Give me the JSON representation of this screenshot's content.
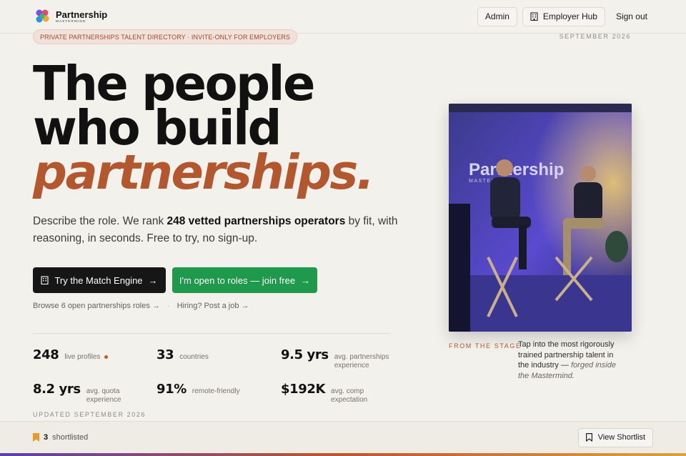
{
  "header": {
    "brand_name": "Partnership",
    "brand_sub": "MASTERMIND",
    "nav": {
      "admin": "Admin",
      "employer_hub": "Employer Hub",
      "sign_out": "Sign out"
    }
  },
  "banner": {
    "pill": "PRIVATE PARTNERSHIPS TALENT DIRECTORY · INVITE-ONLY FOR EMPLOYERS",
    "date": "SEPTEMBER 2026"
  },
  "hero": {
    "line1": "The people",
    "line2": "who build",
    "line3": "partnerships.",
    "lede_pre": "Describe the role. We rank ",
    "lede_bold": "248 vetted partnerships operators",
    "lede_post": " by fit, with reasoning, in seconds. Free to try, no sign-up.",
    "cta_primary": "Try the Match Engine",
    "cta_secondary": "I'm open to roles — join free",
    "link_roles": "Browse 6 open partnerships roles →",
    "link_hiring": "Hiring? Post a job →"
  },
  "stats": [
    {
      "value": "248",
      "label": "live profiles"
    },
    {
      "value": "33",
      "label": "countries"
    },
    {
      "value": "9.5 yrs",
      "label": "avg. partnerships experience"
    },
    {
      "value": "8.2 yrs",
      "label": "avg. quota experience"
    },
    {
      "value": "91%",
      "label": "remote-friendly"
    },
    {
      "value": "$192K",
      "label": "avg. comp expectation"
    }
  ],
  "updated": "UPDATED SEPTEMBER 2026",
  "photo": {
    "stage_text": "Partnership",
    "stage_sub": "MASTERMIND",
    "from_label": "FROM THE STAGE",
    "caption_main": "Tap into the most rigorously trained partnership talent in the industry — ",
    "caption_italic": "forged inside the Mastermind."
  },
  "footer": {
    "count": "3",
    "label": "shortlisted",
    "view_button": "View Shortlist"
  },
  "colors": {
    "accent": "#b3572f",
    "green": "#1f9a4c",
    "dark": "#161616",
    "background": "#f3f1ec"
  }
}
